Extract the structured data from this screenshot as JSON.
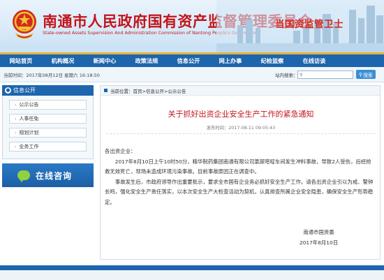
{
  "header": {
    "title": "南通市人民政府国有资产监督管理委员会",
    "subtitle": "State-owned Assets Supervision And Administration Commission of Nantong People's Government",
    "tagline": "当国资监管卫士"
  },
  "nav": [
    "网站首页",
    "机构概况",
    "新闻中心",
    "政策法规",
    "信息公开",
    "网上办事",
    "纪检监察",
    "在线访谈"
  ],
  "infobar": {
    "datetime": "当前时间：2017年08月12日 星期六 16:18:50",
    "search_label": "站内搜索：",
    "search_placeholder": "",
    "search_button": "搜索"
  },
  "sidebar": {
    "heading": "信息公开",
    "items": [
      "公示公告",
      "人事任免",
      "规划计划",
      "业务工作"
    ],
    "consult": "在线咨询"
  },
  "breadcrumb": "当前位置：首页>信息公开>公示公告",
  "article": {
    "title": "关于抓好出资企业安全生产工作的紧急通知",
    "date": "发布时间：2017-08-11 09:05:43",
    "salutation": "各出资企业：",
    "para1": "2017年8月10日上午10时50分，精华制药集团南通有限公司氯尿嘧啶车间发生冲料事故，导致2人受伤，后经抢救无效死亡，现场未造成环境污染事故。目前事故原因正在调查中。",
    "para2": "事故发生后，市政府领导作出重要批示，要求全市国有企业务必抓好安全生产工作。请各出资企业引以为戒、警钟长鸣，强化安全生产责任落实，以本次安全生产大检查活动为契机，认真排查所属企业安全隐患，确保安全生产形势稳定。",
    "signature": "南通市国资委",
    "sign_date": "2017年8月10日"
  },
  "colors": {
    "nav": "#1d65ac",
    "title_red": "#c4141b",
    "accent_gold": "#e8b33a"
  },
  "icons": {
    "emblem": "national-emblem-icon",
    "search": "search-icon",
    "consult": "chat-bubble-icon"
  }
}
